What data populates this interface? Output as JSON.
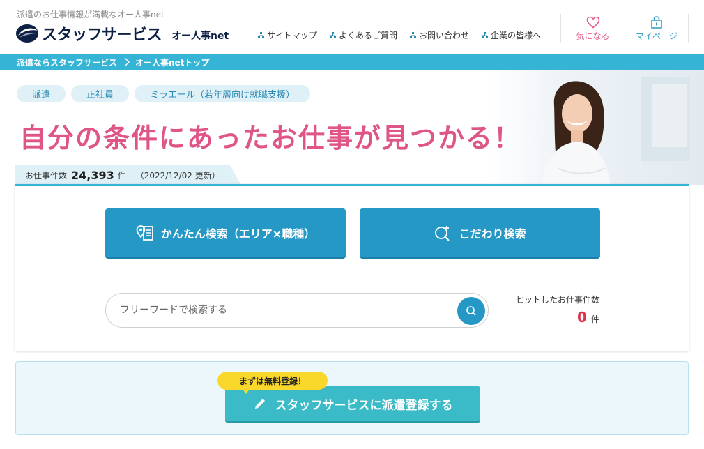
{
  "header": {
    "tagline": "派遣のお仕事情報が満載なオー人事net",
    "logo_text": "スタッフサービス",
    "logo_sub": "オー人事net",
    "nav": [
      {
        "label": "サイトマップ"
      },
      {
        "label": "よくあるご質問"
      },
      {
        "label": "お問い合わせ"
      },
      {
        "label": "企業の皆様へ"
      }
    ],
    "favorite_label": "気になる",
    "mypage_label": "マイページ"
  },
  "breadcrumb": {
    "items": [
      "派遣ならスタッフサービス",
      "オー人事netトップ"
    ]
  },
  "hero": {
    "tags": [
      "派遣",
      "正社員",
      "ミラエール（若年層向け就職支援）"
    ],
    "headline": "自分の条件にあったお仕事が見つかる！",
    "job_count_label": "お仕事件数",
    "job_count": "24,393",
    "job_count_unit": "件",
    "updated": "（2022/12/02 更新）"
  },
  "search": {
    "easy_search_label": "かんたん検索（エリア×職種）",
    "detail_search_label": "こだわり検索",
    "free_word_placeholder": "フリーワードで検索する",
    "hit_label": "ヒットしたお仕事件数",
    "hit_count": "0",
    "hit_unit": "件"
  },
  "register": {
    "badge": "まずは無料登録！",
    "button_label": "スタッフサービスに派遣登録する"
  },
  "colors": {
    "accent": "#36b4d6",
    "button": "#2598c6",
    "headline": "#e05588",
    "hit_number": "#e0334a",
    "badge": "#f9d82b",
    "register_button": "#3bbbc8"
  }
}
